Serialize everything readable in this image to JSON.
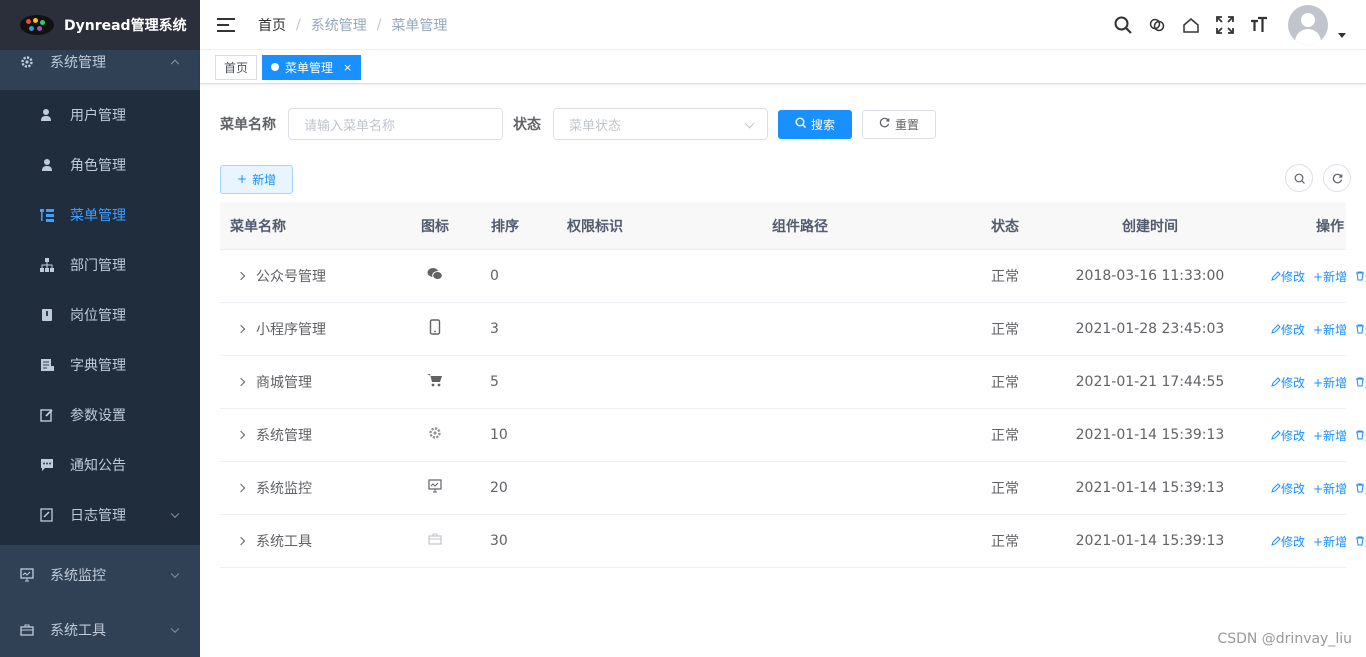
{
  "app": {
    "title": "Dynread管理系统"
  },
  "sidebar": {
    "root_system": "系统管理",
    "items": [
      {
        "label": "用户管理",
        "icon": "user-icon"
      },
      {
        "label": "角色管理",
        "icon": "peoples-icon"
      },
      {
        "label": "菜单管理",
        "icon": "tree-table-icon"
      },
      {
        "label": "部门管理",
        "icon": "tree-icon"
      },
      {
        "label": "岗位管理",
        "icon": "post-icon"
      },
      {
        "label": "字典管理",
        "icon": "dict-icon"
      },
      {
        "label": "参数设置",
        "icon": "edit-icon"
      },
      {
        "label": "通知公告",
        "icon": "message-icon"
      },
      {
        "label": "日志管理",
        "icon": "log-icon"
      }
    ],
    "root_monitor": "系统监控",
    "root_tool": "系统工具"
  },
  "breadcrumb": [
    "首页",
    "系统管理",
    "菜单管理"
  ],
  "tags": {
    "home": "首页",
    "current": "菜单管理",
    "close": "×"
  },
  "search": {
    "name_label": "菜单名称",
    "name_placeholder": "请输入菜单名称",
    "status_label": "状态",
    "status_placeholder": "菜单状态",
    "search_btn": "搜索",
    "reset_btn": "重置"
  },
  "toolbar": {
    "add_btn": "新增"
  },
  "table": {
    "headers": [
      "菜单名称",
      "图标",
      "排序",
      "权限标识",
      "组件路径",
      "状态",
      "创建时间",
      "操作"
    ],
    "rows": [
      {
        "name": "公众号管理",
        "sort": "0",
        "status": "正常",
        "time": "2018-03-16 11:33:00",
        "icon": "wechat-icon"
      },
      {
        "name": "小程序管理",
        "sort": "3",
        "status": "正常",
        "time": "2021-01-28 23:45:03",
        "icon": "phone-icon"
      },
      {
        "name": "商城管理",
        "sort": "5",
        "status": "正常",
        "time": "2021-01-21 17:44:55",
        "icon": "cart-icon"
      },
      {
        "name": "系统管理",
        "sort": "10",
        "status": "正常",
        "time": "2021-01-14 15:39:13",
        "icon": "gear-icon"
      },
      {
        "name": "系统监控",
        "sort": "20",
        "status": "正常",
        "time": "2021-01-14 15:39:13",
        "icon": "monitor-icon"
      },
      {
        "name": "系统工具",
        "sort": "30",
        "status": "正常",
        "time": "2021-01-14 15:39:13",
        "icon": "tool-icon"
      }
    ],
    "ops": {
      "edit": "修改",
      "add": "新增",
      "delete": "删除"
    }
  },
  "watermark": "CSDN @drinvay_liu",
  "colors": {
    "sidebar_bg": "#304156",
    "submenu_bg": "#1f2d3d",
    "primary": "#1890ff"
  }
}
